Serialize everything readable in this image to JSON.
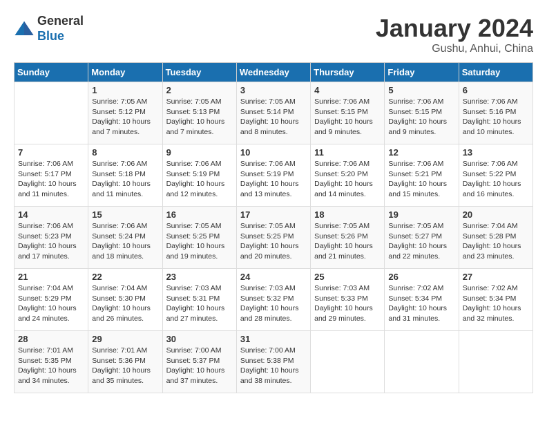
{
  "header": {
    "logo_line1": "General",
    "logo_line2": "Blue",
    "month": "January 2024",
    "location": "Gushu, Anhui, China"
  },
  "weekdays": [
    "Sunday",
    "Monday",
    "Tuesday",
    "Wednesday",
    "Thursday",
    "Friday",
    "Saturday"
  ],
  "weeks": [
    [
      {
        "day": "",
        "sunrise": "",
        "sunset": "",
        "daylight": ""
      },
      {
        "day": "1",
        "sunrise": "Sunrise: 7:05 AM",
        "sunset": "Sunset: 5:12 PM",
        "daylight": "Daylight: 10 hours and 7 minutes."
      },
      {
        "day": "2",
        "sunrise": "Sunrise: 7:05 AM",
        "sunset": "Sunset: 5:13 PM",
        "daylight": "Daylight: 10 hours and 7 minutes."
      },
      {
        "day": "3",
        "sunrise": "Sunrise: 7:05 AM",
        "sunset": "Sunset: 5:14 PM",
        "daylight": "Daylight: 10 hours and 8 minutes."
      },
      {
        "day": "4",
        "sunrise": "Sunrise: 7:06 AM",
        "sunset": "Sunset: 5:15 PM",
        "daylight": "Daylight: 10 hours and 9 minutes."
      },
      {
        "day": "5",
        "sunrise": "Sunrise: 7:06 AM",
        "sunset": "Sunset: 5:15 PM",
        "daylight": "Daylight: 10 hours and 9 minutes."
      },
      {
        "day": "6",
        "sunrise": "Sunrise: 7:06 AM",
        "sunset": "Sunset: 5:16 PM",
        "daylight": "Daylight: 10 hours and 10 minutes."
      }
    ],
    [
      {
        "day": "7",
        "sunrise": "Sunrise: 7:06 AM",
        "sunset": "Sunset: 5:17 PM",
        "daylight": "Daylight: 10 hours and 11 minutes."
      },
      {
        "day": "8",
        "sunrise": "Sunrise: 7:06 AM",
        "sunset": "Sunset: 5:18 PM",
        "daylight": "Daylight: 10 hours and 11 minutes."
      },
      {
        "day": "9",
        "sunrise": "Sunrise: 7:06 AM",
        "sunset": "Sunset: 5:19 PM",
        "daylight": "Daylight: 10 hours and 12 minutes."
      },
      {
        "day": "10",
        "sunrise": "Sunrise: 7:06 AM",
        "sunset": "Sunset: 5:19 PM",
        "daylight": "Daylight: 10 hours and 13 minutes."
      },
      {
        "day": "11",
        "sunrise": "Sunrise: 7:06 AM",
        "sunset": "Sunset: 5:20 PM",
        "daylight": "Daylight: 10 hours and 14 minutes."
      },
      {
        "day": "12",
        "sunrise": "Sunrise: 7:06 AM",
        "sunset": "Sunset: 5:21 PM",
        "daylight": "Daylight: 10 hours and 15 minutes."
      },
      {
        "day": "13",
        "sunrise": "Sunrise: 7:06 AM",
        "sunset": "Sunset: 5:22 PM",
        "daylight": "Daylight: 10 hours and 16 minutes."
      }
    ],
    [
      {
        "day": "14",
        "sunrise": "Sunrise: 7:06 AM",
        "sunset": "Sunset: 5:23 PM",
        "daylight": "Daylight: 10 hours and 17 minutes."
      },
      {
        "day": "15",
        "sunrise": "Sunrise: 7:06 AM",
        "sunset": "Sunset: 5:24 PM",
        "daylight": "Daylight: 10 hours and 18 minutes."
      },
      {
        "day": "16",
        "sunrise": "Sunrise: 7:05 AM",
        "sunset": "Sunset: 5:25 PM",
        "daylight": "Daylight: 10 hours and 19 minutes."
      },
      {
        "day": "17",
        "sunrise": "Sunrise: 7:05 AM",
        "sunset": "Sunset: 5:25 PM",
        "daylight": "Daylight: 10 hours and 20 minutes."
      },
      {
        "day": "18",
        "sunrise": "Sunrise: 7:05 AM",
        "sunset": "Sunset: 5:26 PM",
        "daylight": "Daylight: 10 hours and 21 minutes."
      },
      {
        "day": "19",
        "sunrise": "Sunrise: 7:05 AM",
        "sunset": "Sunset: 5:27 PM",
        "daylight": "Daylight: 10 hours and 22 minutes."
      },
      {
        "day": "20",
        "sunrise": "Sunrise: 7:04 AM",
        "sunset": "Sunset: 5:28 PM",
        "daylight": "Daylight: 10 hours and 23 minutes."
      }
    ],
    [
      {
        "day": "21",
        "sunrise": "Sunrise: 7:04 AM",
        "sunset": "Sunset: 5:29 PM",
        "daylight": "Daylight: 10 hours and 24 minutes."
      },
      {
        "day": "22",
        "sunrise": "Sunrise: 7:04 AM",
        "sunset": "Sunset: 5:30 PM",
        "daylight": "Daylight: 10 hours and 26 minutes."
      },
      {
        "day": "23",
        "sunrise": "Sunrise: 7:03 AM",
        "sunset": "Sunset: 5:31 PM",
        "daylight": "Daylight: 10 hours and 27 minutes."
      },
      {
        "day": "24",
        "sunrise": "Sunrise: 7:03 AM",
        "sunset": "Sunset: 5:32 PM",
        "daylight": "Daylight: 10 hours and 28 minutes."
      },
      {
        "day": "25",
        "sunrise": "Sunrise: 7:03 AM",
        "sunset": "Sunset: 5:33 PM",
        "daylight": "Daylight: 10 hours and 29 minutes."
      },
      {
        "day": "26",
        "sunrise": "Sunrise: 7:02 AM",
        "sunset": "Sunset: 5:34 PM",
        "daylight": "Daylight: 10 hours and 31 minutes."
      },
      {
        "day": "27",
        "sunrise": "Sunrise: 7:02 AM",
        "sunset": "Sunset: 5:34 PM",
        "daylight": "Daylight: 10 hours and 32 minutes."
      }
    ],
    [
      {
        "day": "28",
        "sunrise": "Sunrise: 7:01 AM",
        "sunset": "Sunset: 5:35 PM",
        "daylight": "Daylight: 10 hours and 34 minutes."
      },
      {
        "day": "29",
        "sunrise": "Sunrise: 7:01 AM",
        "sunset": "Sunset: 5:36 PM",
        "daylight": "Daylight: 10 hours and 35 minutes."
      },
      {
        "day": "30",
        "sunrise": "Sunrise: 7:00 AM",
        "sunset": "Sunset: 5:37 PM",
        "daylight": "Daylight: 10 hours and 37 minutes."
      },
      {
        "day": "31",
        "sunrise": "Sunrise: 7:00 AM",
        "sunset": "Sunset: 5:38 PM",
        "daylight": "Daylight: 10 hours and 38 minutes."
      },
      {
        "day": "",
        "sunrise": "",
        "sunset": "",
        "daylight": ""
      },
      {
        "day": "",
        "sunrise": "",
        "sunset": "",
        "daylight": ""
      },
      {
        "day": "",
        "sunrise": "",
        "sunset": "",
        "daylight": ""
      }
    ]
  ]
}
